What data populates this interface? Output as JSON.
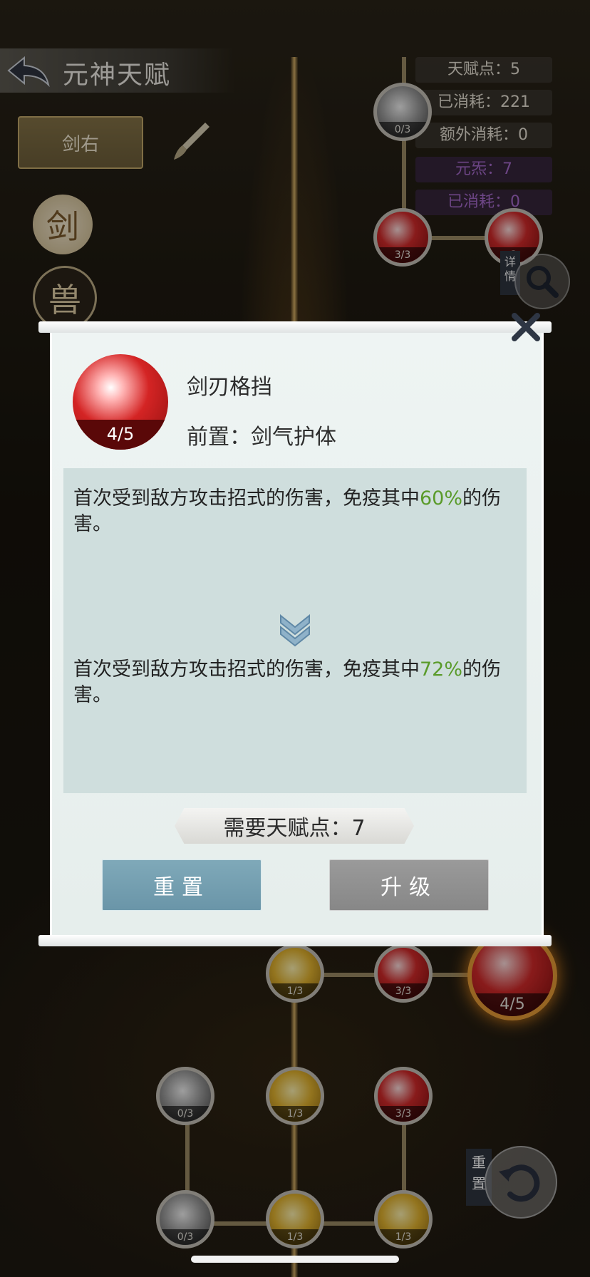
{
  "header": {
    "title": "元神天赋"
  },
  "tabs": {
    "sword_tab": "剑右"
  },
  "side_badges": {
    "sword": "剑",
    "beast": "兽"
  },
  "stats": {
    "talent_points": "天赋点：5",
    "consumed": "已消耗：221",
    "extra_consumed": "额外消耗：0",
    "yuanyuan": "元炁：7",
    "yuan_consumed": "已消耗：0"
  },
  "side_buttons": {
    "detail": "详情",
    "reset": "重置"
  },
  "tree_nodes": {
    "top": "0/3",
    "r1a": "3/3",
    "r1b": "3",
    "n_a": "1/3",
    "n_b": "3/3",
    "n_big": "4/5",
    "n_c": "0/3",
    "n_d": "1/3",
    "n_e": "3/3",
    "n_f": "0/3",
    "n_g": "1/3",
    "n_h": "1/3"
  },
  "modal": {
    "skill_name": "剑刃格挡",
    "skill_level": "4/5",
    "prerequisite": "前置：剑气护体",
    "current": {
      "before": "首次受到敌方攻击招式的伤害，免疫其中",
      "value": "60%",
      "after": "的伤害。"
    },
    "next": {
      "before": "首次受到敌方攻击招式的伤害，免疫其中",
      "value": "72%",
      "after": "的伤害。"
    },
    "cost": "需要天赋点：7",
    "reset_button": "重置",
    "upgrade_button": "升级"
  },
  "colors": {
    "highlight_green": "#5a9b2a",
    "purple_stat": "#a66bcc",
    "reset_button": "#7fa9b9",
    "upgrade_button": "#8f8f8f"
  }
}
